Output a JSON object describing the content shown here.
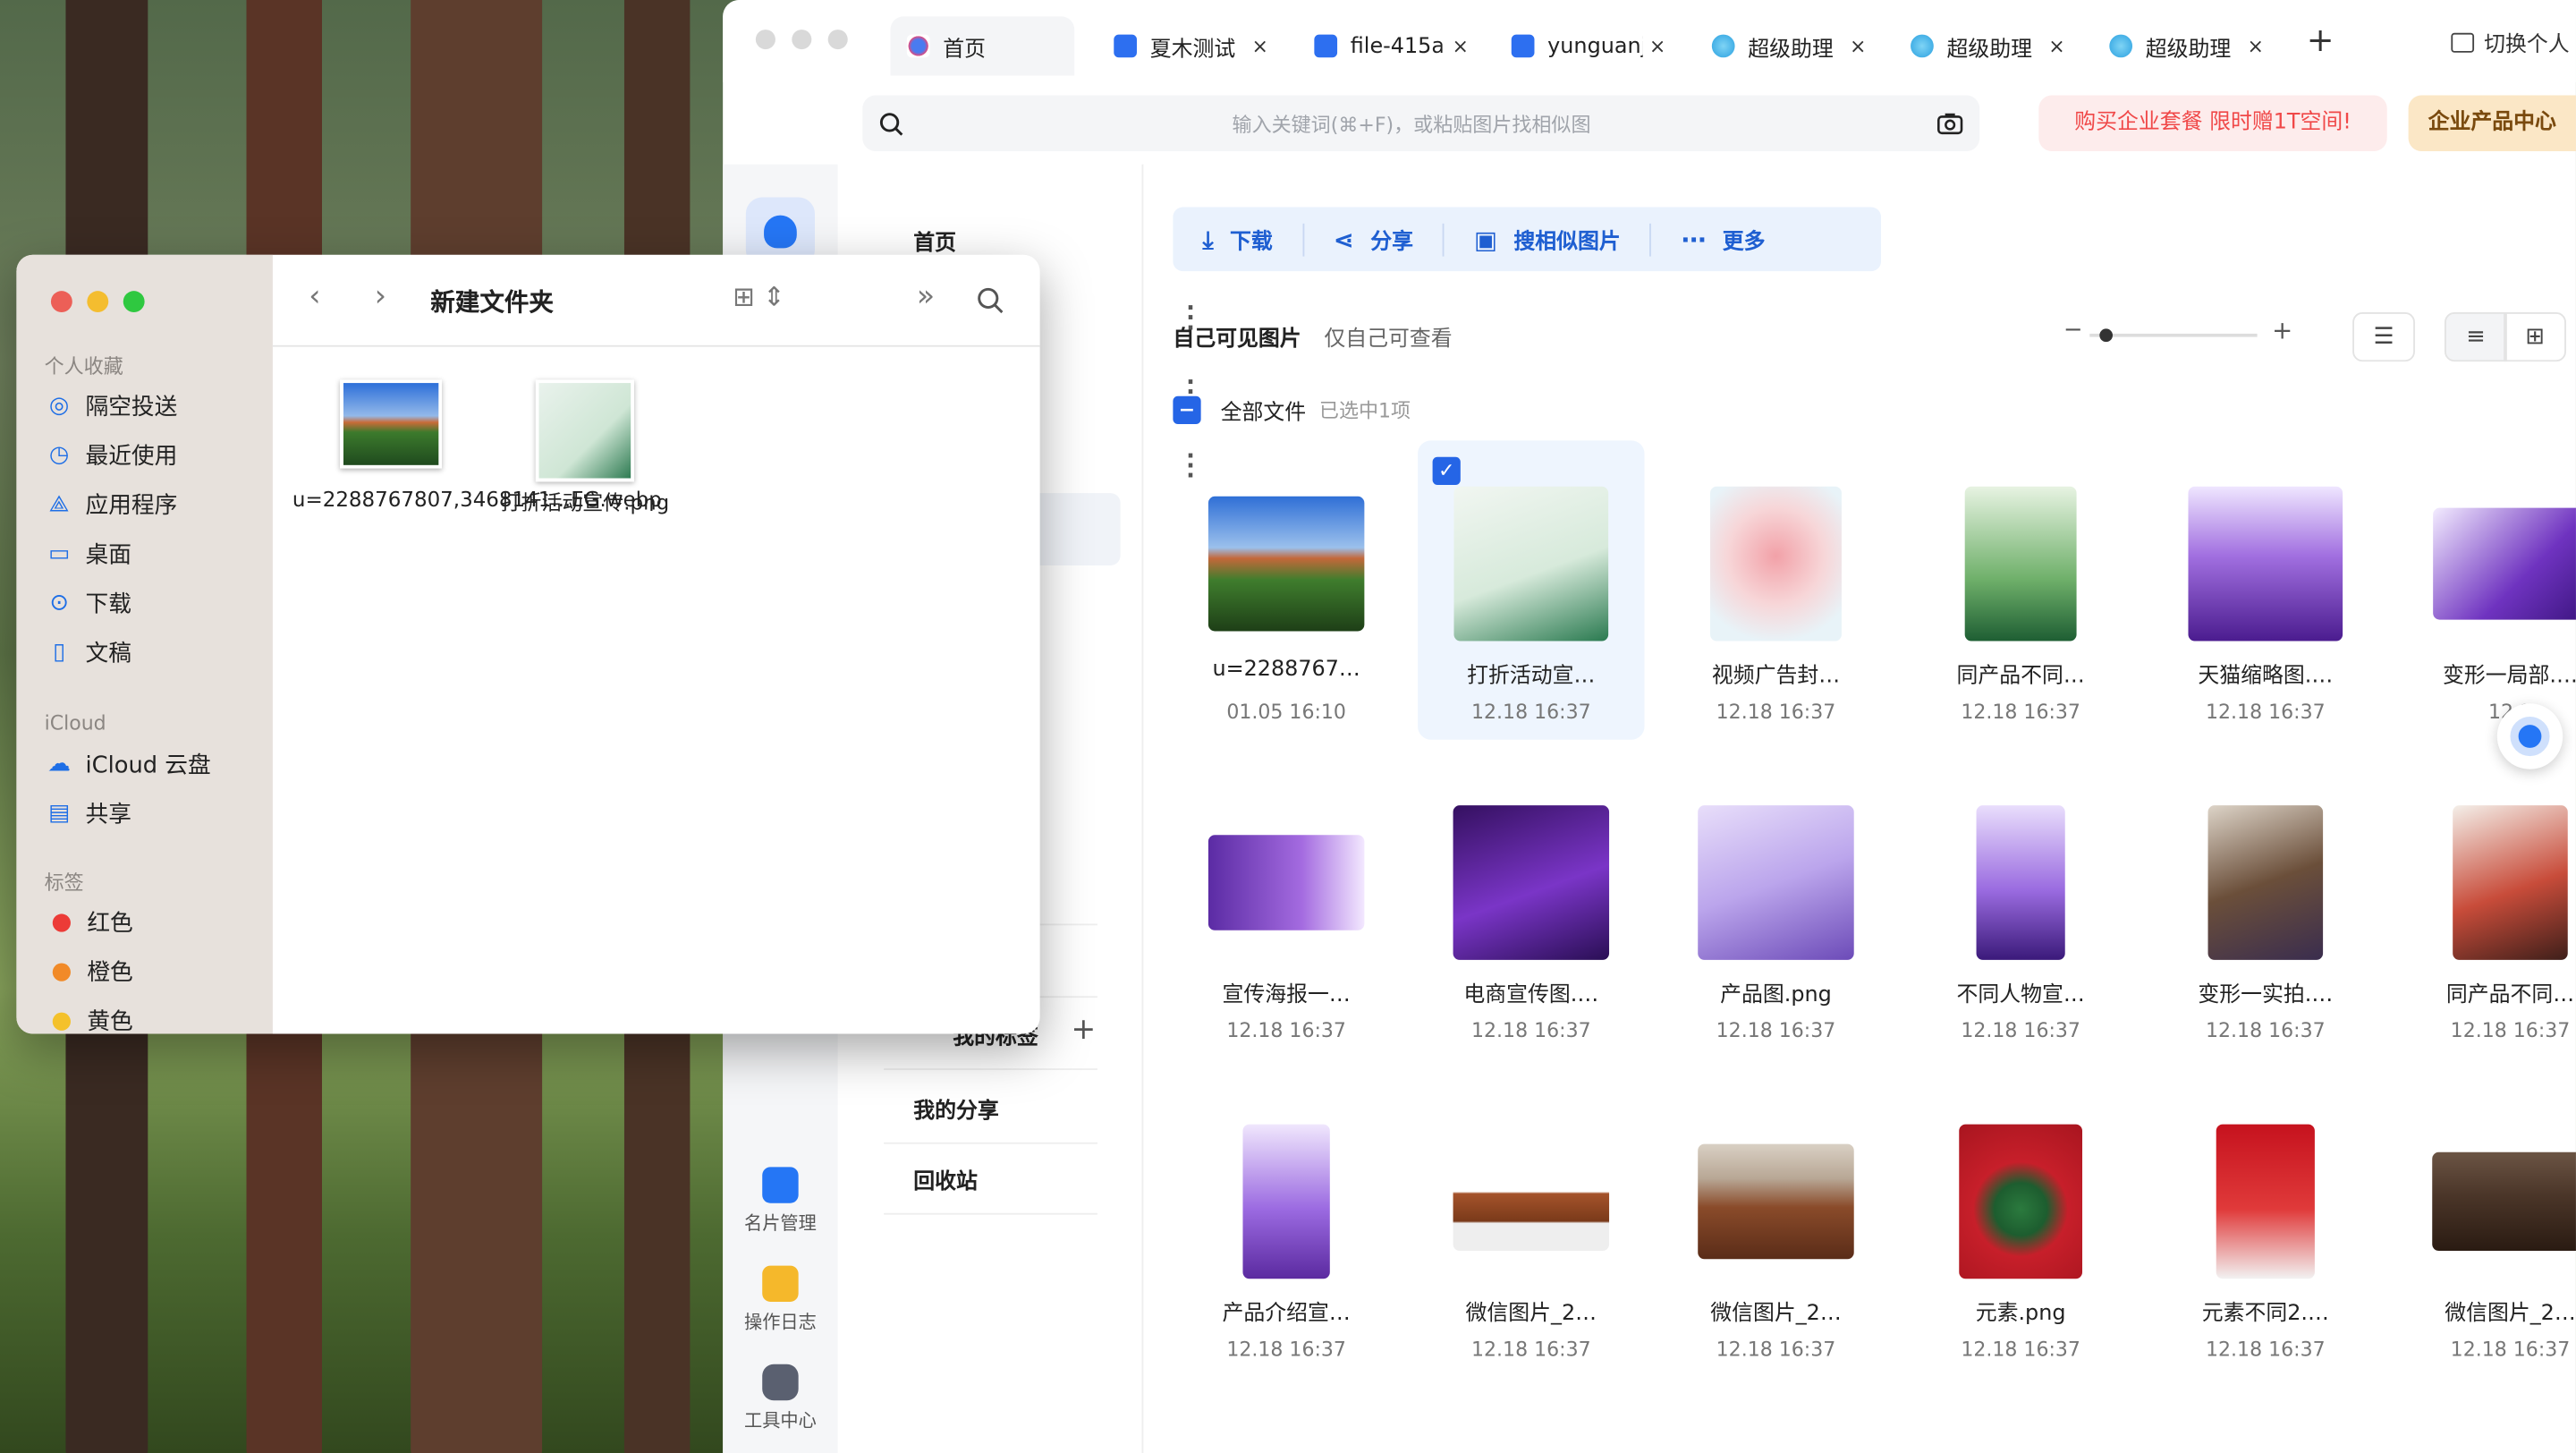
{
  "browser": {
    "tabs": [
      {
        "label": "首页",
        "icon": "people-icon",
        "active": true
      },
      {
        "label": "夏木测试",
        "icon": "doc-icon",
        "close": "×"
      },
      {
        "label": "file-415a",
        "icon": "doc-icon",
        "close": "×"
      },
      {
        "label": "yunguanj",
        "icon": "doc-icon",
        "close": "×"
      },
      {
        "label": "超级助理",
        "icon": "helper-icon",
        "close": "×"
      },
      {
        "label": "超级助理",
        "icon": "helper-icon",
        "close": "×"
      },
      {
        "label": "超级助理",
        "icon": "helper-icon",
        "close": "×"
      }
    ],
    "new_tab": "+",
    "switch_label": "切换个人"
  },
  "header": {
    "search_placeholder": "输入关键词(⌘+F)，或粘贴图片找相似图",
    "promo": "购买企业套餐 限时赠1T空间!",
    "enterprise_center": "企业产品中心"
  },
  "rail": {
    "items": [
      {
        "label": "名片管理",
        "color": "#2576f5"
      },
      {
        "label": "操作日志",
        "color": "#f5b82b"
      },
      {
        "label": "工具中心",
        "color": "#5a6070"
      }
    ]
  },
  "nav": {
    "home": "首页",
    "my_tags": "我的标签",
    "add": "+",
    "my_share": "我的分享",
    "recycle": "回收站"
  },
  "toolbar": {
    "download": "下载",
    "share": "分享",
    "search_similar": "搜相似图片",
    "more": "更多"
  },
  "view": {
    "visible_title": "自己可见图片",
    "visible_sub": "仅自己可查看",
    "all_files": "全部文件",
    "selected_count": "已选中1项",
    "zoom_level": 0.1
  },
  "files": [
    {
      "name": "u=2288767…",
      "date": "01.05 16:10",
      "thumb": "landscape"
    },
    {
      "name": "打折活动宣…",
      "date": "12.18 16:37",
      "thumb": "poster-green",
      "selected": true
    },
    {
      "name": "视频广告封…",
      "date": "12.18 16:37",
      "thumb": "pink-bottle"
    },
    {
      "name": "同产品不同…",
      "date": "12.18 16:37",
      "thumb": "green-bottle"
    },
    {
      "name": "天猫缩略图.…",
      "date": "12.18 16:37",
      "thumb": "purple-box"
    },
    {
      "name": "变形一局部.…",
      "date": "12.1",
      "thumb": "purple-wide"
    },
    {
      "name": "宣传海报一…",
      "date": "12.18 16:37",
      "thumb": "purple-banner"
    },
    {
      "name": "电商宣传图.…",
      "date": "12.18 16:37",
      "thumb": "purple-dark"
    },
    {
      "name": "产品图.png",
      "date": "12.18 16:37",
      "thumb": "lavender"
    },
    {
      "name": "不同人物宣…",
      "date": "12.18 16:37",
      "thumb": "purple-tall"
    },
    {
      "name": "变形一实拍.…",
      "date": "12.18 16:37",
      "thumb": "photo-box"
    },
    {
      "name": "同产品不同…",
      "date": "12.18 16:37",
      "thumb": "red-bottle"
    },
    {
      "name": "产品介绍宣…",
      "date": "12.18 16:37",
      "thumb": "purple-flower"
    },
    {
      "name": "微信图片_2…",
      "date": "12.18 16:37",
      "thumb": "sofa-white"
    },
    {
      "name": "微信图片_2…",
      "date": "12.18 16:37",
      "thumb": "sofa-room"
    },
    {
      "name": "元素.png",
      "date": "12.18 16:37",
      "thumb": "xmas-tree"
    },
    {
      "name": "元素不同2.…",
      "date": "12.18 16:37",
      "thumb": "christmas"
    },
    {
      "name": "微信图片_2…",
      "date": "12.18 16:37",
      "thumb": "sofa-dark"
    }
  ],
  "finder": {
    "title": "新建文件夹",
    "sections": {
      "favorites": "个人收藏",
      "icloud": "iCloud",
      "tags": "标签"
    },
    "favorites": [
      {
        "label": "隔空投送",
        "icon": "airdrop-icon"
      },
      {
        "label": "最近使用",
        "icon": "clock-icon"
      },
      {
        "label": "应用程序",
        "icon": "apps-icon"
      },
      {
        "label": "桌面",
        "icon": "desktop-icon"
      },
      {
        "label": "下载",
        "icon": "download-icon"
      },
      {
        "label": "文稿",
        "icon": "doc-icon"
      }
    ],
    "icloud": [
      {
        "label": "iCloud 云盘",
        "icon": "cloud-icon"
      },
      {
        "label": "共享",
        "icon": "shared-folder-icon"
      }
    ],
    "tags": [
      {
        "label": "红色",
        "color": "#ec3b37"
      },
      {
        "label": "橙色",
        "color": "#f18a28"
      },
      {
        "label": "黄色",
        "color": "#f4c12b"
      }
    ],
    "files": [
      {
        "name": "u=2288767807,3468141...EG.webp"
      },
      {
        "name": "打折活动宣传.png"
      }
    ]
  }
}
